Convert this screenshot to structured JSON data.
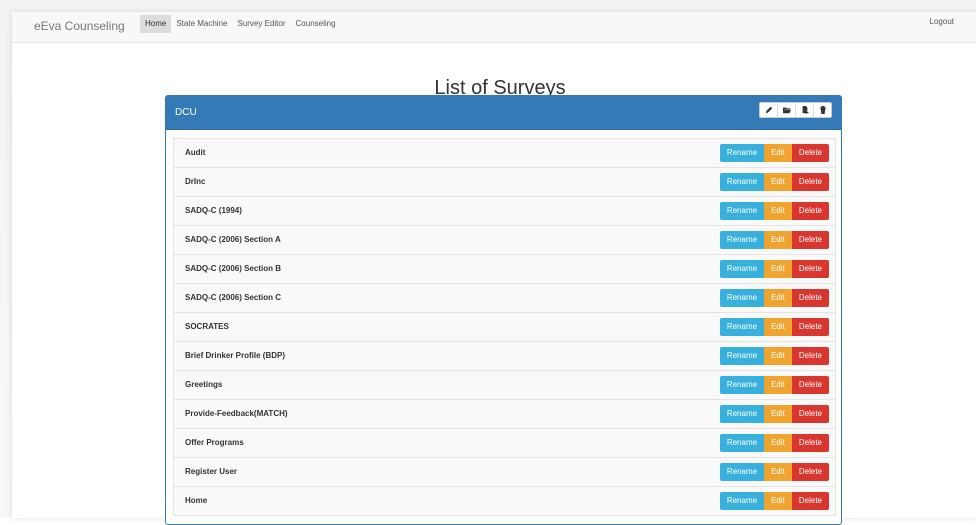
{
  "navbar": {
    "brand": "eEva Counseling",
    "links": [
      "Home",
      "State Machine",
      "Survey Editor",
      "Counseling"
    ],
    "logout": "Logout"
  },
  "page": {
    "title": "List of Surveys"
  },
  "panel": {
    "title": "DCU",
    "tools": [
      "pencil-icon",
      "folder-open-icon",
      "import-icon",
      "trash-icon"
    ]
  },
  "buttons": {
    "rename": "Rename",
    "edit": "Edit",
    "delete": "Delete"
  },
  "surveys": [
    "Audit",
    "DrInc",
    "SADQ-C (1994)",
    "SADQ-C (2006) Section A",
    "SADQ-C (2006) Section B",
    "SADQ-C (2006) Section C",
    "SOCRATES",
    "Brief Drinker Profile (BDP)",
    "Greetings",
    "Provide-Feedback(MATCH)",
    "Offer Programs",
    "Register User",
    "Home"
  ],
  "colors": {
    "primary": "#337ab7",
    "info": "#38b0de",
    "warning": "#f0a430",
    "danger": "#d9362f"
  }
}
